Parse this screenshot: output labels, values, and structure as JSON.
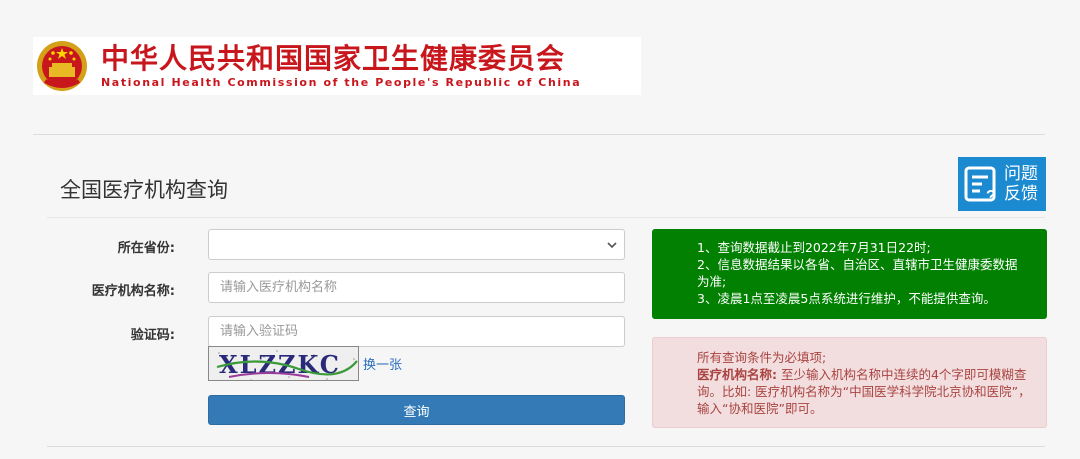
{
  "header": {
    "title_cn": "中华人民共和国国家卫生健康委员会",
    "title_en": "National Health Commission of the People's Republic of China",
    "emblem_icon": "national-emblem-icon"
  },
  "page": {
    "title": "全国医疗机构查询"
  },
  "feedback": {
    "line1": "问题",
    "line2": "反馈",
    "icon": "feedback-document-icon"
  },
  "form": {
    "province_label": "所在省份:",
    "province_value": "",
    "name_label": "医疗机构名称:",
    "name_placeholder": "请输入医疗机构名称",
    "captcha_label": "验证码:",
    "captcha_placeholder": "请输入验证码",
    "captcha_text": "XLZZKC",
    "refresh_label": "换一张",
    "submit_label": "查询"
  },
  "notices": {
    "info": [
      "1、查询数据截止到2022年7月31日22时;",
      "2、信息数据结果以各省、自治区、直辖市卫生健康委数据为准;",
      "3、凌晨1点至凌晨5点系统进行维护，不能提供查询。"
    ],
    "warning_title": "所有查询条件为必填项;",
    "warning_bold": "医疗机构名称:",
    "warning_text": " 至少输入机构名称中连续的4个字即可模糊查询。比如: 医疗机构名称为“中国医学科学院北京协和医院”，输入“协和医院”即可。"
  },
  "colors": {
    "brand_red": "#c8161d",
    "info_green": "#018001",
    "primary_blue": "#337ab7",
    "feedback_blue": "#1c8ad0",
    "warning_bg": "#f2dede"
  }
}
